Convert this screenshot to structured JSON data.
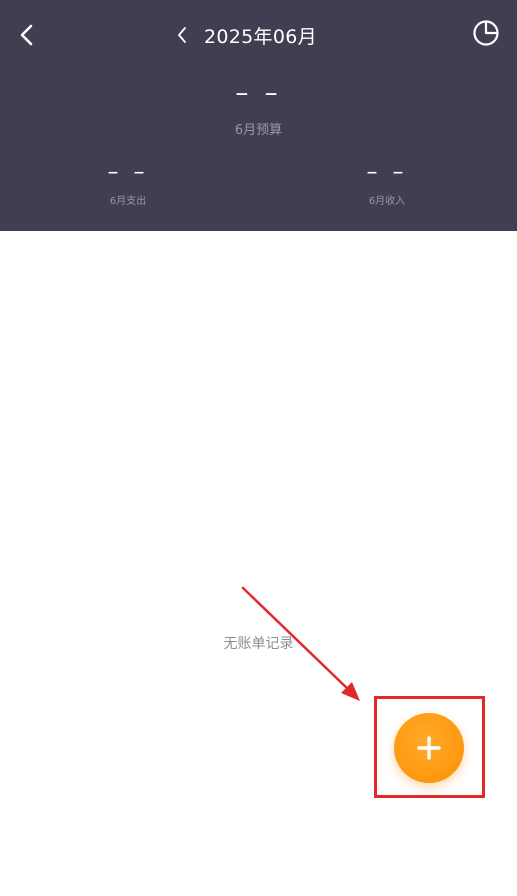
{
  "header": {
    "month_title": "2025年06月",
    "budget": {
      "value": "– –",
      "label": "6月预算"
    },
    "expense": {
      "value": "– –",
      "label": "6月支出"
    },
    "income": {
      "value": "– –",
      "label": "6月收入"
    },
    "icons": {
      "back": "back-arrow-icon",
      "prev_month": "chevron-left-icon",
      "chart": "pie-chart-icon"
    }
  },
  "main": {
    "empty_text": "无账单记录"
  },
  "fab": {
    "icon": "plus-icon"
  },
  "colors": {
    "header_bg": "#423e51",
    "fab": "#ff9a12",
    "annotation": "#e02a2a",
    "muted_text": "#9a96a8"
  }
}
